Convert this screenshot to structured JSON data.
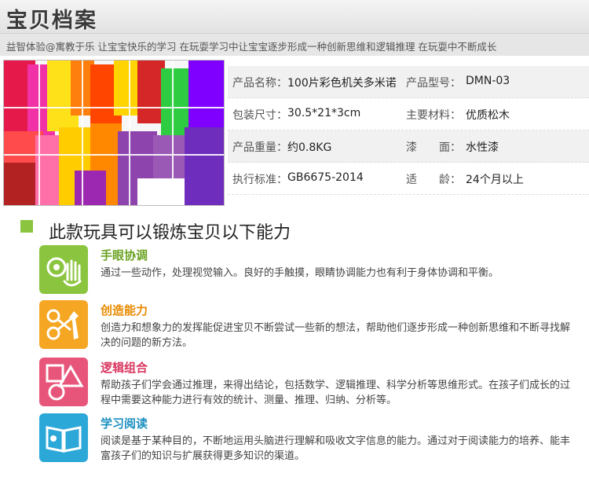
{
  "header": {
    "title": "宝贝档案",
    "subtitle": "益智体验@寓教于乐 让宝宝快乐的学习 在玩耍学习中让宝宝逐步形成一种创新思维和逻辑推理 在玩耍中不断成长"
  },
  "product_info": {
    "rows": [
      {
        "label1": "产品名称：",
        "value1": "100片彩色机关多米诺",
        "label2": "产品型号：",
        "value2": "DMN-03"
      },
      {
        "label1": "包装尺寸：",
        "value1": "30.5*21*3cm",
        "label2": "主要材料：",
        "value2": "优质松木"
      },
      {
        "label1": "产品重量：",
        "value1": "约0.8KG",
        "label2": "漆　　面：",
        "value2": "水性漆"
      },
      {
        "label1": "执行标准：",
        "value1": "GB6675-2014",
        "label2": "适　　龄：",
        "value2": "24个月以上"
      }
    ]
  },
  "abilities_section": {
    "title": "此款玩具可以锻炼宝贝以下能力",
    "items": [
      {
        "title": "手眼协调",
        "desc": "通过一些动作，处理视觉输入。良好的手触摸，眼睛协调能力也有利于身体协调和平衡。",
        "color": "#8bc53f",
        "icon": "eye-hand-icon"
      },
      {
        "title": "创造能力",
        "desc": "创造力和想象力的发挥能促进宝贝不断尝试一些新的想法，帮助他们逐步形成一种创新思维和不断寻找解决的问题的新方法。",
        "color": "#f5a623",
        "icon": "tools-icon"
      },
      {
        "title": "逻辑组合",
        "desc": "帮助孩子们学会通过推理，来得出结论，包括数学、逻辑推理、科学分析等思维形式。在孩子们成长的过程中需要这种能力进行有效的统计、测量、推理、归纳、分析等。",
        "color": "#e8557a",
        "icon": "shapes-icon"
      },
      {
        "title": "学习阅读",
        "desc": "阅读是基于某种目的，不断地运用头脑进行理解和吸收文字信息的能力。通过对于阅读能力的培养、能丰富孩子们的知识与扩展获得更多知识的渠道。",
        "color": "#2ba7d8",
        "icon": "book-icon"
      }
    ]
  }
}
